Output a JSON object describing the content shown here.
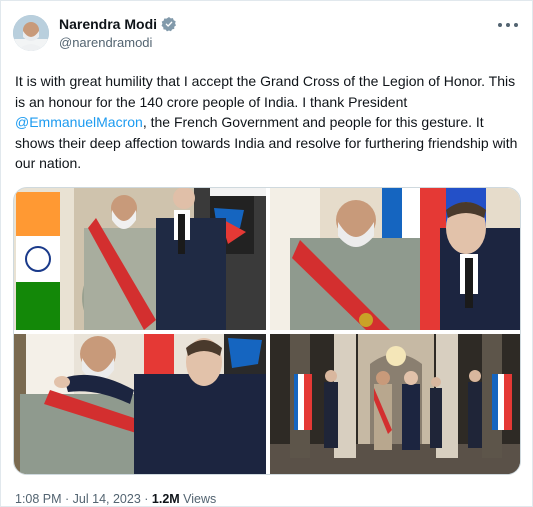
{
  "author": {
    "display_name": "Narendra Modi",
    "handle": "@narendramodi",
    "avatar_icon": "avatar-photo",
    "verified_icon": "verified-badge-icon"
  },
  "menu": {
    "icon": "more-options-icon"
  },
  "tweet": {
    "text_part1": "It is with great humility that I accept the Grand Cross of the Legion of Honor. This is an honour for the 140 crore people of India. I thank President ",
    "mention": "@EmmanuelMacron",
    "text_part2": ", the French Government and people for this gesture. It shows their deep affection towards India and resolve for furthering friendship with our nation."
  },
  "media": {
    "photos": [
      {
        "name": "photo-award-ceremony-with-flags"
      },
      {
        "name": "photo-medal-presentation-closeup"
      },
      {
        "name": "photo-sash-being-placed"
      },
      {
        "name": "photo-hall-with-guard-of-honour"
      }
    ]
  },
  "meta": {
    "time": "1:08 PM",
    "separator": " · ",
    "date": "Jul 14, 2023",
    "views_count": "1.2M",
    "views_label": "Views"
  },
  "colors": {
    "link": "#1d9bf0",
    "secondary_text": "#536471",
    "primary_text": "#0f1419"
  }
}
